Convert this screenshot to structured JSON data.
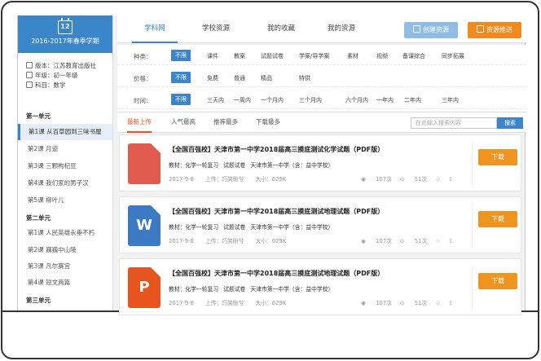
{
  "sidebar": {
    "calendar_day": "12",
    "term": "2016-2017年春季学期",
    "publisher": "版本：江苏教育出版社",
    "grade": "年级：初一年级",
    "subject": "科目：数学",
    "units": [
      {
        "title": "第一单元",
        "lessons": [
          "第1课 从百草园到三味书屋",
          "第2课 月迹",
          "第3课 三颗枸杞豆",
          "第4课 我们家的男子汉",
          "第5课 柳叶儿"
        ]
      },
      {
        "title": "第二单元",
        "lessons": [
          "第1课 人民英雄永垂不朽",
          "第2课 巍巍中山陵",
          "第3课 凡尔赛宫",
          "第4课 短文两篇"
        ]
      },
      {
        "title": "第三单元",
        "lessons": []
      }
    ],
    "active_lesson": "第1课 从百草园到三味书屋"
  },
  "topnav": {
    "tabs": [
      "学科网",
      "学校资源",
      "我的收藏",
      "我的资源"
    ],
    "active_tab": "学科网",
    "create_button": "创建资源",
    "push_button": "资源推送"
  },
  "filters": {
    "type": {
      "label": "种类：",
      "options": [
        "不限",
        "课件",
        "教案",
        "试题试卷",
        "学案/导学案",
        "素材",
        "视频",
        "备课综合",
        "同步拓展"
      ]
    },
    "price": {
      "label": "价格：",
      "options": [
        "不限",
        "免费",
        "普通",
        "精品",
        "特供"
      ]
    },
    "time": {
      "label": "时间：",
      "options": [
        "不限",
        "三天内",
        "一周内",
        "一个月内",
        "三个月内",
        "六个月内",
        "一年内",
        "二年内",
        "三年内"
      ]
    }
  },
  "sortbar": {
    "sorts": [
      "最新上传",
      "人气最高",
      "推荐最多",
      "下载最多"
    ],
    "active_sort": "最新上传",
    "search_placeholder": "在此输入搜索内容",
    "search_button": "搜索"
  },
  "resources": [
    {
      "icon": "pdf-icon",
      "icon_text": "",
      "title": "【全国百强校】天津市第一中学2018届高三摸底测试化学试题（PDF版）",
      "material": "教材：化学一轮复习",
      "type": "试题试卷",
      "school": "天津市第一中学（含：益中学校）",
      "date": "2017-9-8",
      "uploader": "上传：巧笑盼兮",
      "size": "大小：629K",
      "views": "107次",
      "downloads": "51次",
      "download_button": "下载"
    },
    {
      "icon": "word-icon",
      "icon_text": "W",
      "title": "【全国百强校】天津市第一中学2018届高三摸底测试地理试题（PDF版）",
      "material": "教材：化学一轮复习",
      "type": "试题试卷",
      "school": "天津市第一中学（含：益中学校）",
      "date": "2017-9-8",
      "uploader": "上传：巧笑盼兮",
      "size": "大小：629K",
      "views": "107次",
      "downloads": "51次",
      "download_button": "下载"
    },
    {
      "icon": "ppt-icon",
      "icon_text": "P",
      "title": "【全国百强校】天津市第一中学2018届高三摸底测试地理试题（PDF版）",
      "material": "教材：化学一轮复习",
      "type": "试题试卷",
      "school": "天津市第一中学（含：益中学校）",
      "date": "2017-9-8",
      "uploader": "上传：巧笑盼兮",
      "size": "大小：629K",
      "views": "107次",
      "downloads": "51次",
      "download_button": "下载"
    }
  ],
  "colors": {
    "primary": "#3a86c9",
    "accent": "#f08a1e",
    "active_sort": "#e8541e"
  }
}
